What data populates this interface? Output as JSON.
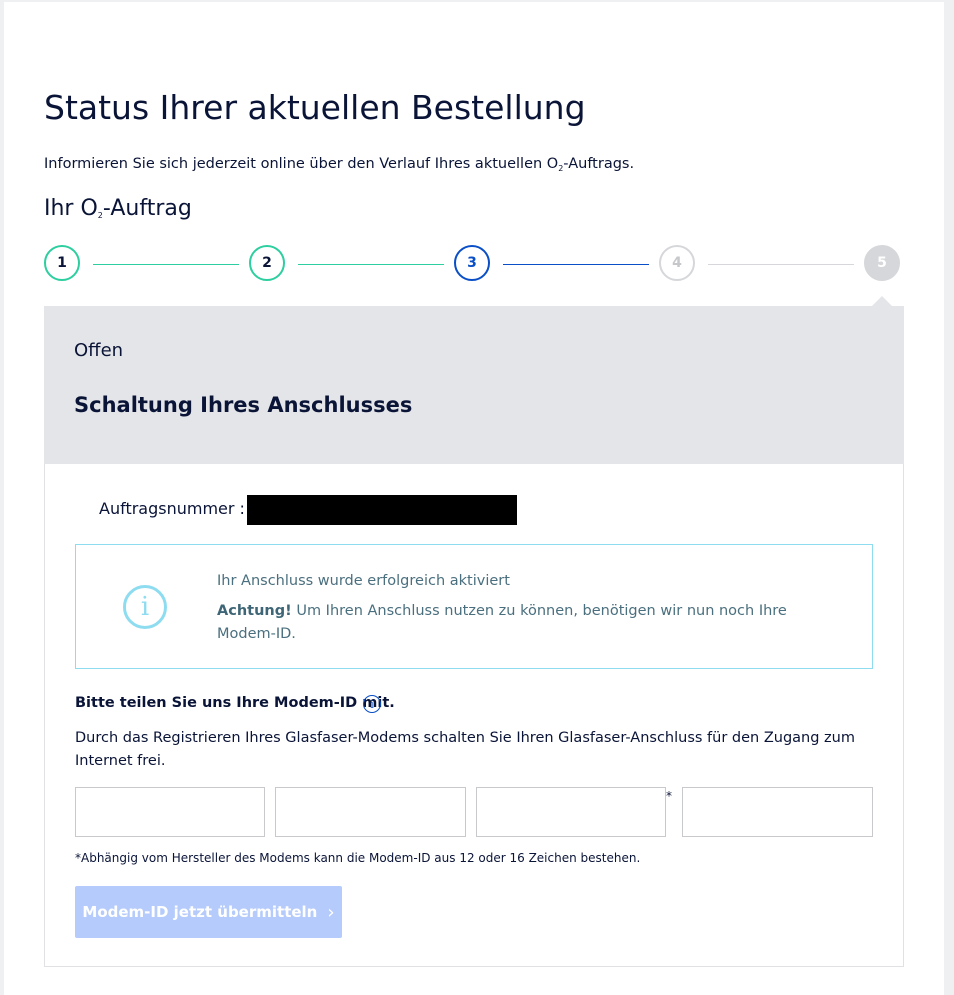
{
  "header": {
    "title": "Status Ihrer aktuellen Bestellung",
    "intro_prefix": "Informieren Sie sich jederzeit online über den Verlauf Ihres aktuellen O",
    "intro_sub": "2",
    "intro_suffix": "-Auftrags.",
    "order_prefix": "Ihr O",
    "order_sub": "2",
    "order_suffix": "-Auftrag"
  },
  "stepper": {
    "steps": [
      {
        "label": "1",
        "state": "done"
      },
      {
        "label": "2",
        "state": "done"
      },
      {
        "label": "3",
        "state": "current"
      },
      {
        "label": "4",
        "state": "future"
      },
      {
        "label": "5",
        "state": "future"
      }
    ],
    "colors": {
      "done": "#2dce9f",
      "current": "#0a4fc7",
      "future": "#d6d7da"
    }
  },
  "status_card": {
    "status": "Offen",
    "title": "Schaltung Ihres Anschlusses"
  },
  "order": {
    "number_label": "Auftragsnummer :",
    "number_value": ""
  },
  "info_box": {
    "icon": "info-icon",
    "line1": "Ihr Anschluss wurde erfolgreich aktiviert",
    "bold": "Achtung!",
    "line2": "Um Ihren Anschluss nutzen zu können, benötigen wir nun noch Ihre Modem-ID."
  },
  "modem": {
    "heading": "Bitte teilen Sie uns Ihre Modem-ID mit.",
    "help_icon": "info-icon",
    "description": "Durch das Registrieren Ihres Glasfaser-Modems schalten Sie Ihren Glasfaser-Anschluss für den Zugang zum Internet frei.",
    "inputs": [
      "",
      "",
      "",
      ""
    ],
    "asterisk": "*",
    "footnote": "*Abhängig vom Hersteller des Modems kann die Modem-ID aus 12 oder 16 Zeichen bestehen.",
    "submit_label": "Modem-ID jetzt übermitteln",
    "submit_icon": "chevron-right-icon"
  }
}
